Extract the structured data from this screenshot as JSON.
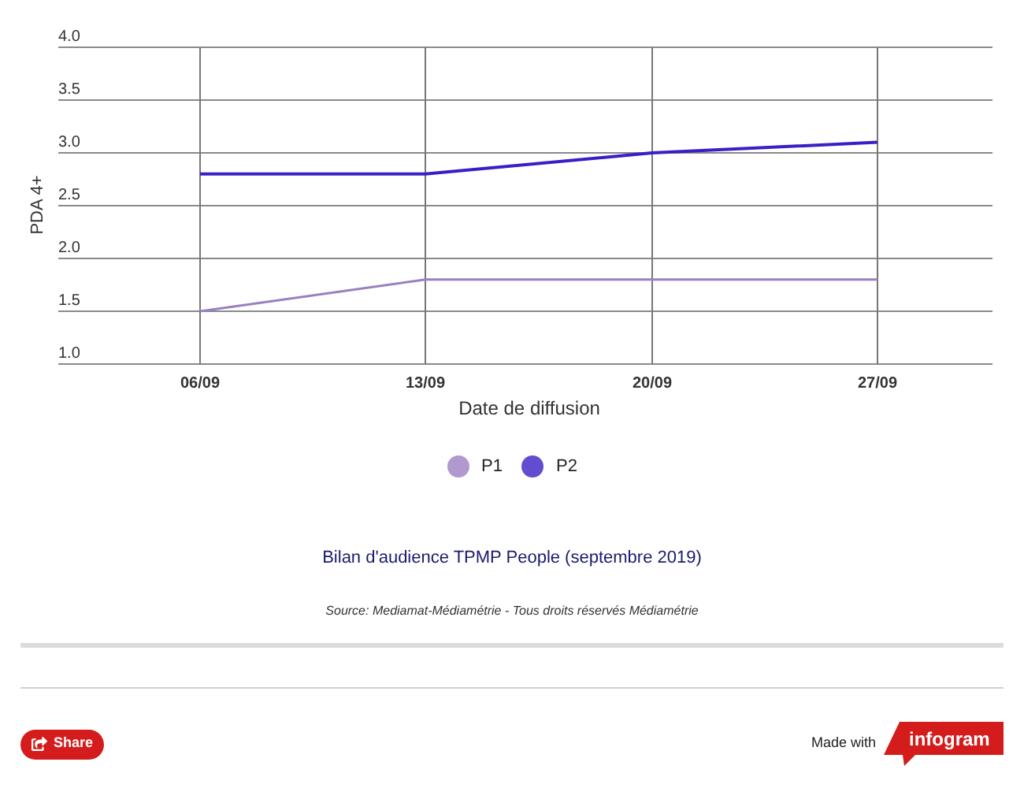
{
  "chart": {
    "chart_data": {
      "type": "line",
      "grid": true,
      "xlabel": "Date de diffusion",
      "ylabel": "PDA 4+",
      "categories": [
        "06/09",
        "13/09",
        "20/09",
        "27/09"
      ],
      "series": [
        {
          "name": "P1",
          "color": "#9b7fc0",
          "values": [
            1.5,
            1.8,
            1.8,
            1.8
          ]
        },
        {
          "name": "P2",
          "color": "#3b1fc4",
          "values": [
            2.8,
            2.8,
            3.0,
            3.1
          ]
        }
      ],
      "ylim": [
        1.0,
        4.0
      ],
      "yticks": [
        {
          "value": 1.0,
          "label": "1.0"
        },
        {
          "value": 1.5,
          "label": "1.5"
        },
        {
          "value": 2.0,
          "label": "2.0"
        },
        {
          "value": 2.5,
          "label": "2.5"
        },
        {
          "value": 3.0,
          "label": "3.0"
        },
        {
          "value": 3.5,
          "label": "3.5"
        },
        {
          "value": 4.0,
          "label": "4.0"
        }
      ]
    },
    "title": "Bilan d'audience TPMP People (septembre 2019)",
    "source": "Source: Mediamat-Médiamétrie - Tous droits réservés Médiamétrie"
  },
  "footer": {
    "share_button": "Share",
    "made_with": "Made with",
    "logo": "infogram"
  }
}
